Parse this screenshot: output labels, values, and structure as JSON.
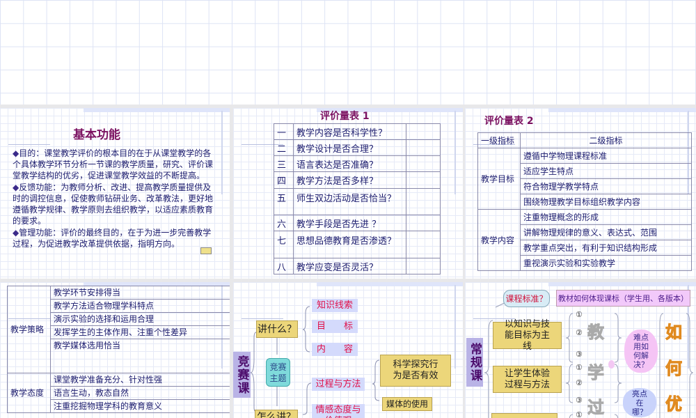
{
  "slide1": {
    "title": "基本功能",
    "bullets": [
      "目的：课堂教学评价的根本目的在于从课堂教学的各个具体教学环节分析一节课的教学质量，研究、评价课堂教学结构的优劣，促进课堂教学效益的不断提高。",
      "反馈功能：为教师分析、改进、提高教学质量提供及时的调控信息，促使教师钻研业务、改革教法，更好地遵循教学规律、教学原则去组织教学，以适应素质教育的要求。",
      "管理功能：评价的最终目的，在于为进一步完善教学过程，为促进教学改革提供依据，指明方向。"
    ]
  },
  "slide2": {
    "title": "评价量表 1",
    "rows": [
      {
        "n": "一",
        "q": "教学内容是否科学性？"
      },
      {
        "n": "二",
        "q": "教学设计是否合理？"
      },
      {
        "n": "三",
        "q": "语言表达是否准确？"
      },
      {
        "n": "四",
        "q": "教学方法是否多样？"
      },
      {
        "n": "五",
        "q": "师生双边活动是否恰当？"
      },
      {
        "n": "六",
        "q": "教学手段是否先进 ？"
      },
      {
        "n": "七",
        "q": "思想品德教育是否渗透？"
      },
      {
        "n": "八",
        "q": "教学应变是否灵活？"
      }
    ]
  },
  "slide3": {
    "title": "评价量表 2",
    "h1": "一级指标",
    "h2": "二级指标",
    "g1": "教学目标",
    "g1items": [
      "遵循中学物理课程标准",
      "适应学生特点",
      "符合物理学教学特点",
      "围绕物理教学目标组织教学内容"
    ],
    "g2": "教学内容",
    "g2items": [
      "注重物理概念的形成",
      "讲解物理规律的意义、表达式、范围",
      "教学重点突出，有利于知识结构形成",
      "重视演示实验和实验教学"
    ]
  },
  "slide4": {
    "g1": "教学策略",
    "g1items": [
      "教学环节安排得当",
      "教学方法适合物理学科特点",
      "演示实验的选择和运用合理",
      "发挥学生的主体作用、注重个性差异",
      "教学媒体选用恰当"
    ],
    "g2": "教学态度",
    "g2items": [
      "课堂教学准备充分、针对性强",
      "语言生动，教态自然",
      "注重挖掘物理学科的教育意义"
    ]
  },
  "slide5": {
    "side": "竞赛课",
    "center": "竞赛主题",
    "what": "讲什么？",
    "how": "怎么讲？",
    "k1": "知识线索",
    "k2": "目　　标",
    "k3": "内　　容",
    "p1": "过程与方法",
    "p2": "情感态度与价值观",
    "s1": "科学探究行为是否有效",
    "s2": "媒体的使用"
  },
  "slide6": {
    "side": "常规课",
    "callout": "课程标准？",
    "note": "教材如何体现课标（学生用、各版本）",
    "b1": "以知识与技能目标为主线",
    "b2": "让学生体验过程与方法",
    "nums": [
      "①",
      "②",
      "③"
    ],
    "big": [
      "教",
      "学",
      "过"
    ],
    "cloud1": "难点用如何解决？",
    "cloud2": "亮点在哪？",
    "right": [
      "如",
      "何",
      "优"
    ]
  }
}
